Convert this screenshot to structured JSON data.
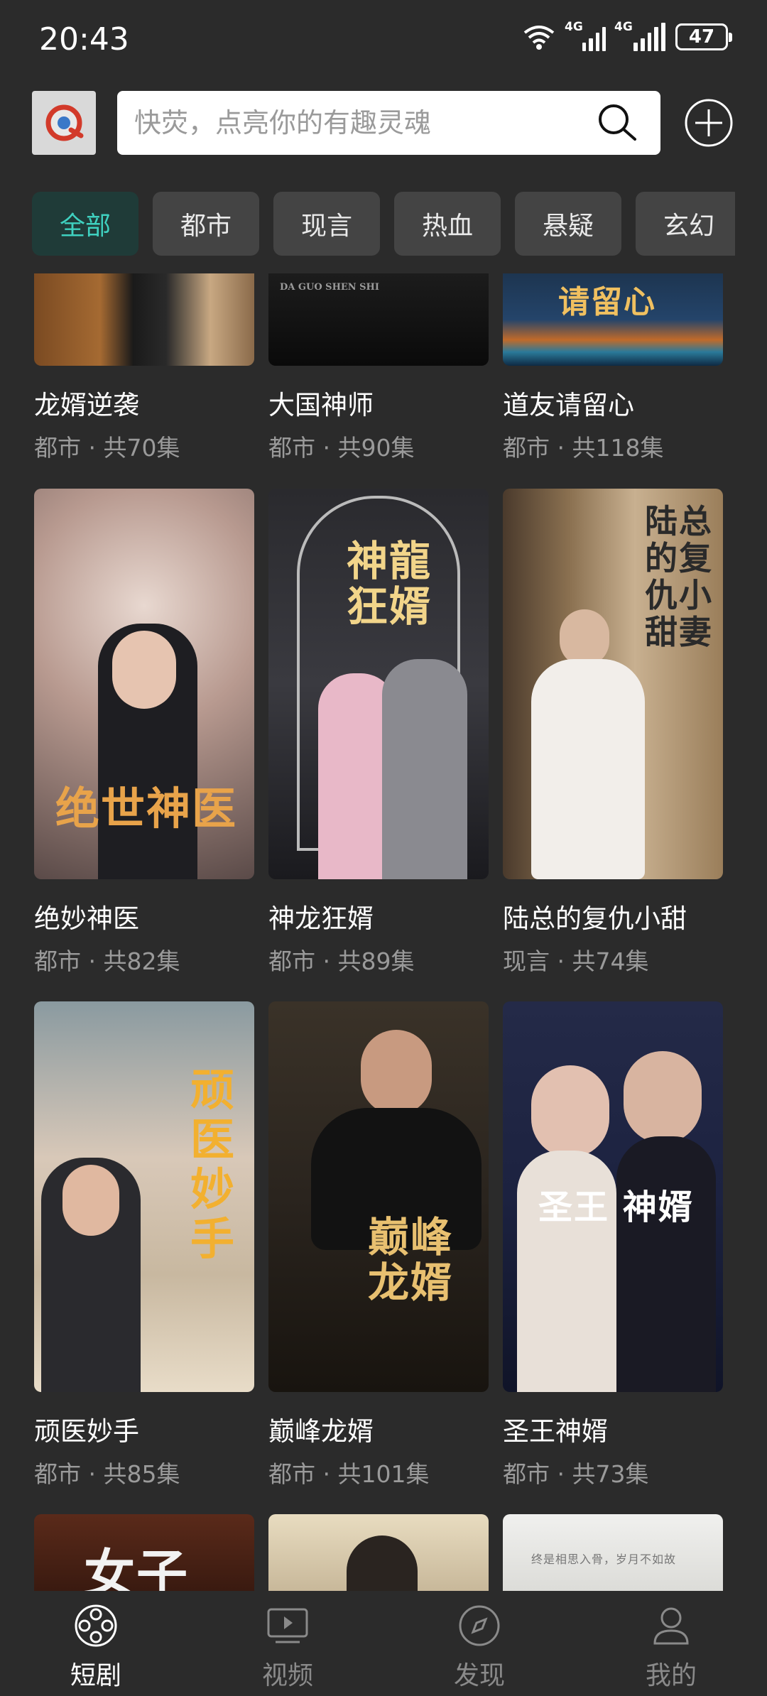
{
  "status_bar": {
    "time": "20:43",
    "network1": "4G",
    "network2": "4G",
    "battery": "47"
  },
  "search": {
    "placeholder": "快荧，点亮你的有趣灵魂"
  },
  "categories": [
    "全部",
    "都市",
    "现言",
    "热血",
    "悬疑",
    "玄幻"
  ],
  "partial_top_row": [
    {
      "title": "龙婿逆袭",
      "meta": "都市 · 共70集"
    },
    {
      "title": "大国神师",
      "meta": "都市 · 共90集",
      "poster_text": "DA GUO SHEN SHI"
    },
    {
      "title": "道友请留心",
      "meta": "都市 · 共118集",
      "poster_text": "请留心"
    }
  ],
  "dramas": [
    {
      "title": "绝妙神医",
      "meta": "都市 · 共82集",
      "poster_text": "绝世神医"
    },
    {
      "title": "神龙狂婿",
      "meta": "都市 · 共89集",
      "poster_text": "神龍狂婿"
    },
    {
      "title": "陆总的复仇小甜",
      "meta": "现言 · 共74集",
      "poster_text": "陆总的复仇小甜妻"
    },
    {
      "title": "顽医妙手",
      "meta": "都市 · 共85集",
      "poster_text": "顽医妙手"
    },
    {
      "title": "巅峰龙婿",
      "meta": "都市 · 共101集",
      "poster_text": "巅峰龙婿"
    },
    {
      "title": "圣王神婿",
      "meta": "都市 · 共73集",
      "poster_text": "圣王 神婿"
    }
  ],
  "partial_bottom_row": [
    {
      "poster_text": "女子"
    },
    {
      "poster_text": ""
    },
    {
      "poster_text": "终是相思入骨，岁月不如故"
    }
  ],
  "bottom_nav": [
    {
      "label": "短剧",
      "icon": "film-reel-icon",
      "active": true
    },
    {
      "label": "视频",
      "icon": "video-play-icon",
      "active": false
    },
    {
      "label": "发现",
      "icon": "compass-icon",
      "active": false
    },
    {
      "label": "我的",
      "icon": "user-icon",
      "active": false
    }
  ],
  "colors": {
    "background": "#2b2b2b",
    "accent": "#3fd1c0",
    "tab_bg": "#444444",
    "meta_text": "#9a9a9a"
  }
}
